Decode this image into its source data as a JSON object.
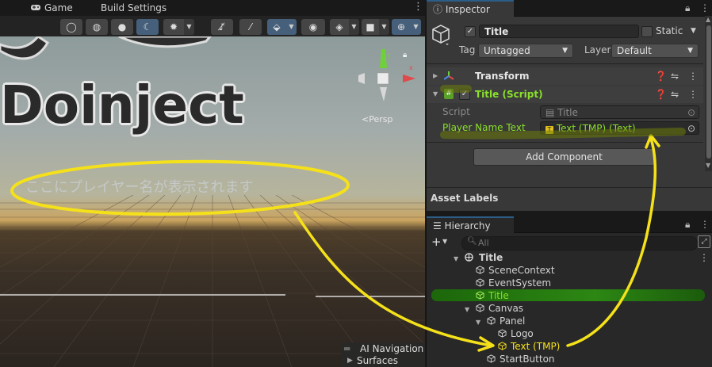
{
  "scene": {
    "tabs": [
      "Game",
      "Build Settings"
    ],
    "logo_text": "Doinject",
    "player_name_placeholder": "ここにプレイヤー名が表示されます",
    "persp_label": "<Persp",
    "ai_navigation": "AI Navigation",
    "surfaces": "Surfaces",
    "toolbar_icons": [
      "wireframe-icon",
      "shaded-wire-icon",
      "shaded-icon",
      "lighting-icon",
      "debug-icon",
      "audio-mute-icon",
      "fx-icon",
      "gizmo-icon",
      "visibility-icon",
      "layers-icon",
      "camera-icon",
      "global-icon"
    ]
  },
  "inspector": {
    "tab_label": "Inspector",
    "object_name": "Title",
    "static_label": "Static",
    "tag_label": "Tag",
    "tag_value": "Untagged",
    "layer_label": "Layer",
    "layer_value": "Default",
    "components": [
      {
        "name": "Transform"
      },
      {
        "name": "Title (Script)"
      }
    ],
    "script_label": "Script",
    "script_value": "Title",
    "player_name_text_label": "Player Name Text",
    "player_name_text_value": "Text (TMP) (Text)",
    "add_component": "Add Component",
    "asset_labels": "Asset Labels"
  },
  "hierarchy": {
    "tab_label": "Hierarchy",
    "search_placeholder": "All",
    "items": [
      {
        "label": "Title",
        "depth": 0
      },
      {
        "label": "SceneContext",
        "depth": 1
      },
      {
        "label": "EventSystem",
        "depth": 1
      },
      {
        "label": "Title",
        "depth": 1
      },
      {
        "label": "Canvas",
        "depth": 1
      },
      {
        "label": "Panel",
        "depth": 2
      },
      {
        "label": "Logo",
        "depth": 3
      },
      {
        "label": "Text (TMP)",
        "depth": 3
      },
      {
        "label": "StartButton",
        "depth": 2
      }
    ]
  },
  "colors": {
    "annotation_yellow": "#f5e11a",
    "highlight_green": "#1f7d0b",
    "selected_text_green": "#8ae02a"
  }
}
